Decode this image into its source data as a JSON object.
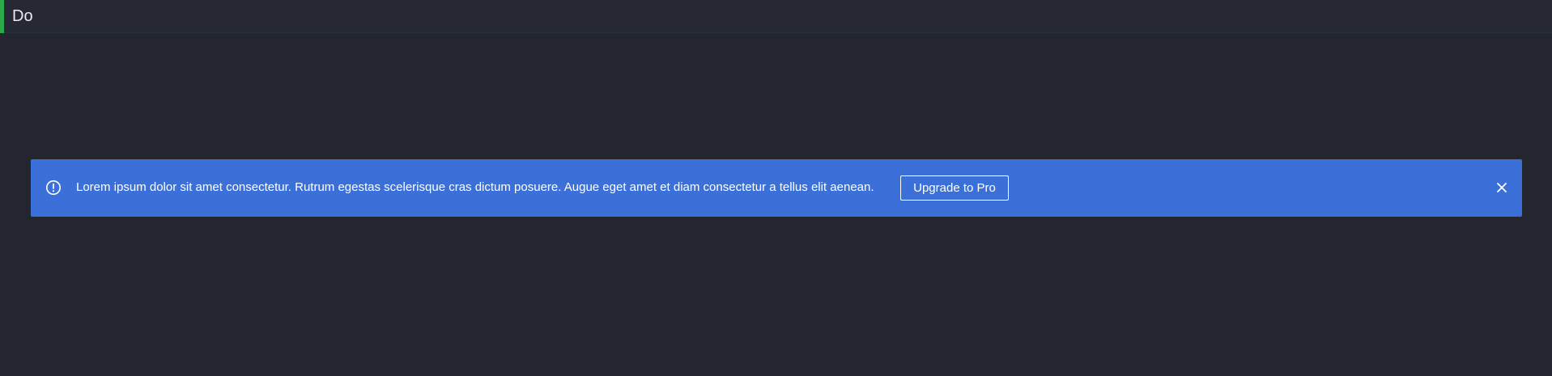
{
  "header": {
    "title": "Do"
  },
  "banner": {
    "icon": "info-circle-icon",
    "message": "Lorem ipsum dolor sit amet consectetur. Rutrum egestas scelerisque cras dictum posuere. Augue eget amet et diam consectetur a tellus elit aenean.",
    "cta_label": "Upgrade to Pro",
    "close_icon": "close-icon"
  },
  "colors": {
    "background": "#23262f",
    "header_background": "#262933",
    "accent": "#2aa84a",
    "banner": "#3b70d9",
    "banner_text": "#ffffff"
  }
}
